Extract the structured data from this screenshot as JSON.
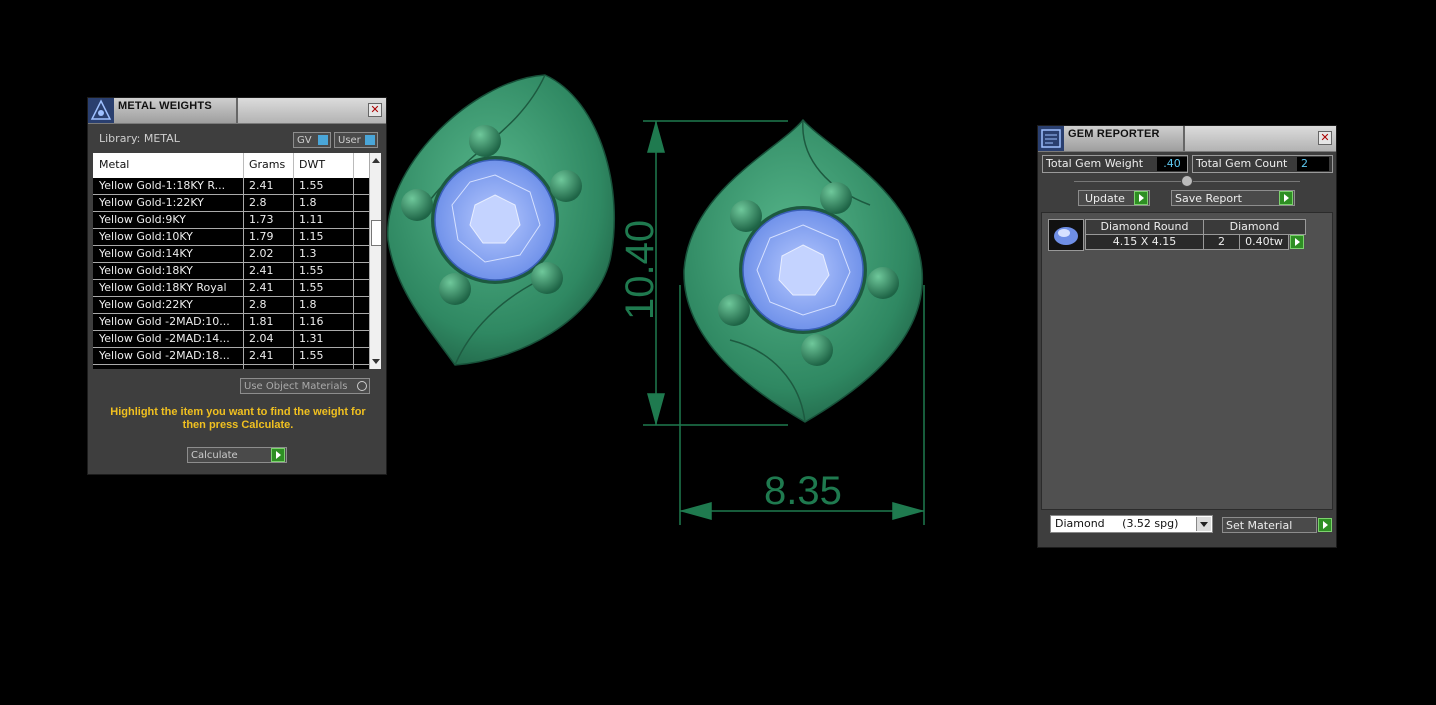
{
  "metal_weights": {
    "title": "METAL WEIGHTS",
    "library_label": "Library: METAL",
    "gv_label": "GV",
    "user_label": "User",
    "columns": [
      "Metal",
      "Grams",
      "DWT"
    ],
    "rows": [
      [
        "Yellow Gold-1:18KY R...",
        "2.41",
        "1.55"
      ],
      [
        "Yellow Gold-1:22KY",
        "2.8",
        "1.8"
      ],
      [
        "Yellow Gold:9KY",
        "1.73",
        "1.11"
      ],
      [
        "Yellow Gold:10KY",
        "1.79",
        "1.15"
      ],
      [
        "Yellow Gold:14KY",
        "2.02",
        "1.3"
      ],
      [
        "Yellow Gold:18KY",
        "2.41",
        "1.55"
      ],
      [
        "Yellow Gold:18KY Royal",
        "2.41",
        "1.55"
      ],
      [
        "Yellow Gold:22KY",
        "2.8",
        "1.8"
      ],
      [
        "Yellow Gold -2MAD:10...",
        "1.81",
        "1.16"
      ],
      [
        "Yellow Gold -2MAD:14...",
        "2.04",
        "1.31"
      ],
      [
        "Yellow Gold -2MAD:18...",
        "2.41",
        "1.55"
      ]
    ],
    "use_object_materials": "Use Object Materials",
    "hint": "Highlight the item you want to find the weight for then press Calculate.",
    "calculate_label": "Calculate"
  },
  "gem_reporter": {
    "title": "GEM REPORTER",
    "total_weight_label": "Total Gem Weight",
    "total_weight_value": ".40",
    "total_count_label": "Total Gem Count",
    "total_count_value": "2",
    "update_label": "Update",
    "save_report_label": "Save Report",
    "gem": {
      "shape": "Diamond Round",
      "material": "Diamond",
      "size": "4.15 X 4.15",
      "count": "2",
      "weight": "0.40tw"
    },
    "material_select": "Diamond     (3.52 spg)",
    "set_material_label": "Set Material"
  },
  "viewport": {
    "dimension_height": "10.40",
    "dimension_width": "8.35"
  },
  "colors": {
    "metal_green": "#2e8a66",
    "gem_blue": "#7a9cf0",
    "dimension_green": "#1f7a4f",
    "hint_yellow": "#f0c020"
  }
}
